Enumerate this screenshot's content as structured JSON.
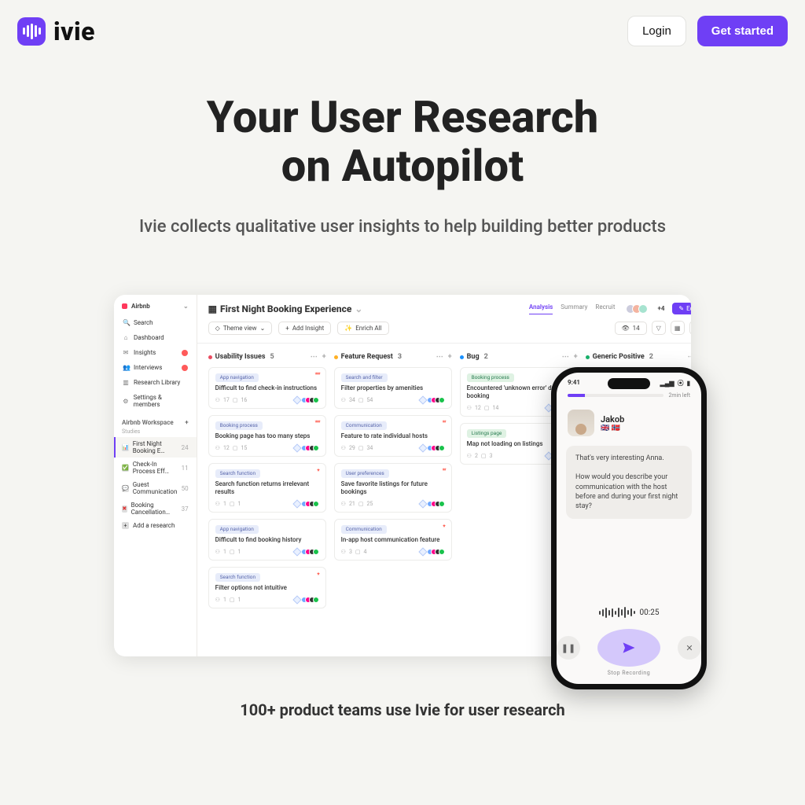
{
  "nav": {
    "brand": "ivie",
    "login": "Login",
    "cta": "Get started"
  },
  "hero": {
    "title_l1": "Your User Research",
    "title_l2": "on Autopilot",
    "subtitle": "Ivie collects qualitative user insights to help building better products"
  },
  "app": {
    "workspace": "Airbnb",
    "nav": {
      "search": "Search",
      "dashboard": "Dashboard",
      "insights": "Insights",
      "interviews": "Interviews",
      "library": "Research Library",
      "settings": "Settings & members"
    },
    "workspace_label": "Airbnb Workspace",
    "studies_label": "Studies",
    "studies": [
      {
        "name": "First Night Booking E…",
        "count": "24",
        "sel": true,
        "icon": "📊"
      },
      {
        "name": "Check-In Process Eff…",
        "count": "11",
        "icon": "✅"
      },
      {
        "name": "Guest Communication",
        "count": "50",
        "icon": "💬"
      },
      {
        "name": "Booking Cancellation…",
        "count": "37",
        "icon": "✖",
        "red": true
      }
    ],
    "add_research": "Add a research",
    "title": "First Night Booking Experience",
    "tabs": [
      "Analysis",
      "Summary",
      "Recruit"
    ],
    "plus_count": "+4",
    "edit": "Edit",
    "toolbar": {
      "view": "Theme view",
      "add": "Add Insight",
      "enrich": "Enrich All",
      "count": "14"
    },
    "columns": [
      {
        "key": "usability",
        "name": "Usability Issues",
        "count": 5,
        "color": "b-red",
        "cards": [
          {
            "tag": "App navigation",
            "star": "***",
            "title": "Difficult to find check-in instructions",
            "m1": "17",
            "m2": "16"
          },
          {
            "tag": "Booking process",
            "star": "***",
            "title": "Booking page has too many steps",
            "m1": "12",
            "m2": "15"
          },
          {
            "tag": "Search function",
            "star": "*",
            "title": "Search function returns irrelevant results",
            "m1": "1",
            "m2": "1"
          },
          {
            "tag": "App navigation",
            "title": "Difficult to find booking history",
            "m1": "1",
            "m2": "1"
          },
          {
            "tag": "Search function",
            "star": "*",
            "title": "Filter options not intuitive",
            "m1": "1",
            "m2": "1"
          }
        ]
      },
      {
        "key": "feature",
        "name": "Feature Request",
        "count": 3,
        "color": "b-yel",
        "cards": [
          {
            "tag": "Search and filter",
            "title": "Filter properties by amenities",
            "m1": "34",
            "m2": "54"
          },
          {
            "tag": "Communication",
            "star": "**",
            "title": "Feature to rate individual hosts",
            "m1": "29",
            "m2": "34"
          },
          {
            "tag": "User preferences",
            "star": "**",
            "title": "Save favorite listings for future bookings",
            "m1": "21",
            "m2": "25"
          },
          {
            "tag": "Communication",
            "star": "*",
            "title": "In-app host communication feature",
            "m1": "3",
            "m2": "4"
          }
        ]
      },
      {
        "key": "bug",
        "name": "Bug",
        "count": 2,
        "color": "b-blu",
        "cards": [
          {
            "tag": "Booking process",
            "tagc": "teal",
            "title": "Encountered 'unknown error' during booking",
            "m1": "12",
            "m2": "14"
          },
          {
            "tag": "Listings page",
            "tagc": "teal",
            "title": "Map not loading on listings",
            "m1": "2",
            "m2": "3"
          }
        ]
      },
      {
        "key": "positive",
        "name": "Generic Positive",
        "count": 2,
        "color": "b-grn",
        "cards": []
      }
    ]
  },
  "phone": {
    "time": "9:41",
    "time_left": "2min left",
    "host": "Jakob",
    "flags": "🇬🇧 🇳🇴",
    "msg_l1": "That's very interesting Anna.",
    "msg_l2": "How would you describe your communication with the host before and during your first night stay?",
    "timer": "00:25",
    "stop": "Stop Recording"
  },
  "proof": "100+ product teams use Ivie for user research"
}
